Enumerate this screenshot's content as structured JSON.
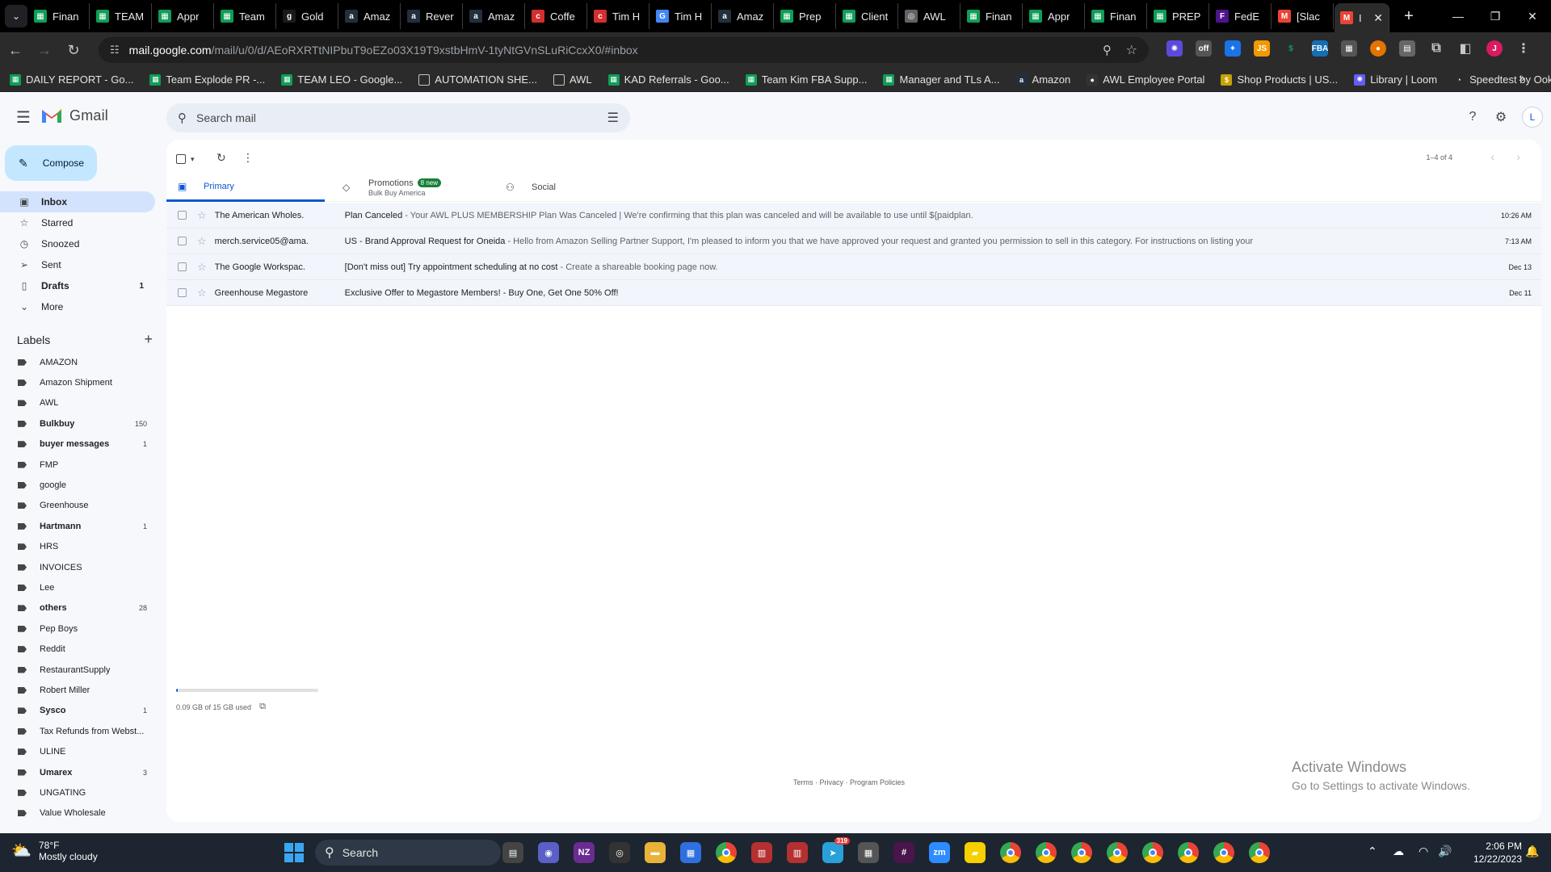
{
  "browser": {
    "tabs": [
      {
        "label": "Finan",
        "icon": "sheets-icon",
        "color": "#0f9d58"
      },
      {
        "label": "TEAM",
        "icon": "sheets-icon",
        "color": "#0f9d58"
      },
      {
        "label": "Appr",
        "icon": "sheets-icon",
        "color": "#0f9d58"
      },
      {
        "label": "Team",
        "icon": "sheets-icon",
        "color": "#0f9d58"
      },
      {
        "label": "Gold",
        "icon": "goldenpages-icon",
        "color": "#1a1a1a"
      },
      {
        "label": "Amaz",
        "icon": "amazon-icon",
        "color": "#232f3e"
      },
      {
        "label": "Rever",
        "icon": "amazon-icon",
        "color": "#232f3e"
      },
      {
        "label": "Amaz",
        "icon": "amazon-icon",
        "color": "#232f3e"
      },
      {
        "label": "Coffe",
        "icon": "coffee-icon",
        "color": "#d32f2f"
      },
      {
        "label": "Tim H",
        "icon": "coffee-icon",
        "color": "#d32f2f"
      },
      {
        "label": "Tim H",
        "icon": "google-icon",
        "color": "#4285f4"
      },
      {
        "label": "Amaz",
        "icon": "amazon-icon",
        "color": "#232f3e"
      },
      {
        "label": "Prep",
        "icon": "sheets-icon",
        "color": "#0f9d58"
      },
      {
        "label": "Client",
        "icon": "sheets-icon",
        "color": "#0f9d58"
      },
      {
        "label": "AWL",
        "icon": "globe-icon",
        "color": "#5f6368"
      },
      {
        "label": "Finan",
        "icon": "sheets-icon",
        "color": "#0f9d58"
      },
      {
        "label": "Appr",
        "icon": "sheets-icon",
        "color": "#0f9d58"
      },
      {
        "label": "Finan",
        "icon": "sheets-icon",
        "color": "#0f9d58"
      },
      {
        "label": "PREP",
        "icon": "sheets-icon",
        "color": "#0f9d58"
      },
      {
        "label": "FedE",
        "icon": "fedex-icon",
        "color": "#4d148c"
      },
      {
        "label": "[Slac",
        "icon": "gmail-icon",
        "color": "#ea4335"
      },
      {
        "label": "I",
        "icon": "gmail-icon",
        "color": "#ea4335"
      }
    ],
    "url_host": "mail.google.com",
    "url_path": "/mail/u/0/d/AEoRXRTtNIPbuT9oEZo03X19T9xstbHmV-1tyNtGVnSLuRiCcxX0/#inbox",
    "profile_initial": "J",
    "bookmarks": [
      {
        "label": "DAILY REPORT - Go...",
        "icon": "sheets-icon",
        "color": "#0f9d58"
      },
      {
        "label": "Team Explode PR -...",
        "icon": "sheets-icon",
        "color": "#0f9d58"
      },
      {
        "label": "TEAM LEO - Google...",
        "icon": "sheets-icon",
        "color": "#0f9d58"
      },
      {
        "label": "AUTOMATION SHE...",
        "icon": "folder-icon",
        "color": "#2b2b2b"
      },
      {
        "label": "AWL",
        "icon": "folder-icon",
        "color": "#2b2b2b"
      },
      {
        "label": "KAD Referrals - Goo...",
        "icon": "sheets-icon",
        "color": "#0f9d58"
      },
      {
        "label": "Team Kim FBA Supp...",
        "icon": "sheets-icon",
        "color": "#0f9d58"
      },
      {
        "label": "Manager and TLs A...",
        "icon": "sheets-icon",
        "color": "#0f9d58"
      },
      {
        "label": "Amazon",
        "icon": "amazon-icon",
        "color": "#232f3e"
      },
      {
        "label": "AWL Employee Portal",
        "icon": "circle-icon",
        "color": "#333"
      },
      {
        "label": "Shop Products | US...",
        "icon": "shop-icon",
        "color": "#c8a200"
      },
      {
        "label": "Library | Loom",
        "icon": "loom-icon",
        "color": "#625df5"
      },
      {
        "label": "Speedtest by Ookla...",
        "icon": "speedtest-icon",
        "color": "#2b2b2b"
      }
    ]
  },
  "gmail": {
    "app_name": "Gmail",
    "search_placeholder": "Search mail",
    "account_initial": "L",
    "compose_label": "Compose",
    "nav": [
      {
        "label": "Inbox",
        "icon": "inbox-icon",
        "count": "",
        "active": true,
        "bold": true
      },
      {
        "label": "Starred",
        "icon": "star-icon",
        "count": "",
        "active": false,
        "bold": false
      },
      {
        "label": "Snoozed",
        "icon": "clock-icon",
        "count": "",
        "active": false,
        "bold": false
      },
      {
        "label": "Sent",
        "icon": "send-icon",
        "count": "",
        "active": false,
        "bold": false
      },
      {
        "label": "Drafts",
        "icon": "draft-icon",
        "count": "1",
        "active": false,
        "bold": true
      },
      {
        "label": "More",
        "icon": "chevron-down-icon",
        "count": "",
        "active": false,
        "bold": false
      }
    ],
    "labels_title": "Labels",
    "labels": [
      {
        "name": "AMAZON",
        "count": "",
        "bold": false
      },
      {
        "name": "Amazon Shipment",
        "count": "",
        "bold": false
      },
      {
        "name": "AWL",
        "count": "",
        "bold": false
      },
      {
        "name": "Bulkbuy",
        "count": "150",
        "bold": true
      },
      {
        "name": "buyer messages",
        "count": "1",
        "bold": true
      },
      {
        "name": "FMP",
        "count": "",
        "bold": false
      },
      {
        "name": "google",
        "count": "",
        "bold": false
      },
      {
        "name": "Greenhouse",
        "count": "",
        "bold": false
      },
      {
        "name": "Hartmann",
        "count": "1",
        "bold": true
      },
      {
        "name": "HRS",
        "count": "",
        "bold": false
      },
      {
        "name": "INVOICES",
        "count": "",
        "bold": false
      },
      {
        "name": "Lee",
        "count": "",
        "bold": false
      },
      {
        "name": "others",
        "count": "28",
        "bold": true
      },
      {
        "name": "Pep Boys",
        "count": "",
        "bold": false
      },
      {
        "name": "Reddit",
        "count": "",
        "bold": false
      },
      {
        "name": "RestaurantSupply",
        "count": "",
        "bold": false
      },
      {
        "name": "Robert Miller",
        "count": "",
        "bold": false
      },
      {
        "name": "Sysco",
        "count": "1",
        "bold": true
      },
      {
        "name": "Tax Refunds from Webst...",
        "count": "",
        "bold": false
      },
      {
        "name": "ULINE",
        "count": "",
        "bold": false
      },
      {
        "name": "Umarex",
        "count": "3",
        "bold": true
      },
      {
        "name": "UNGATING",
        "count": "",
        "bold": false
      },
      {
        "name": "Value Wholesale",
        "count": "",
        "bold": false
      }
    ],
    "pager_text": "1–4 of 4",
    "category_tabs": [
      {
        "label": "Primary",
        "icon": "inbox-icon",
        "sub": "",
        "badge": ""
      },
      {
        "label": "Promotions",
        "icon": "tag-icon",
        "sub": "Bulk Buy America",
        "badge": "8 new"
      },
      {
        "label": "Social",
        "icon": "people-icon",
        "sub": "",
        "badge": ""
      }
    ],
    "emails": [
      {
        "from": "The American Wholes.",
        "subject": "Plan Canceled",
        "snippet": " - Your AWL PLUS MEMBERSHIP Plan Was Canceled | We're confirming that this plan was canceled and will be available to use until ${paidplan.",
        "date": "10:26 AM"
      },
      {
        "from": "merch.service05@ama.",
        "subject": "US - Brand Approval Request for Oneida",
        "snippet": " - Hello from Amazon Selling Partner Support, I'm pleased to inform you that we have approved your request and granted you permission to sell in this category. For instructions on listing your",
        "date": "7:13 AM"
      },
      {
        "from": "The Google Workspac.",
        "subject": "[Don't miss out] Try appointment scheduling at no cost",
        "snippet": " - Create a shareable booking page now.",
        "date": "Dec 13"
      },
      {
        "from": "Greenhouse Megastore",
        "subject": "Exclusive Offer to Megastore Members! - Buy One, Get One 50% Off!",
        "snippet": " - Buy One, Get One 50% Off!",
        "date": "Dec 11"
      }
    ],
    "storage_text": "0.09 GB of 15 GB used",
    "storage_fraction": 0.006,
    "footer": {
      "terms": "Terms",
      "privacy": "Privacy",
      "policies": "Program Policies",
      "sep": " · "
    }
  },
  "watermark": {
    "line1": "Activate Windows",
    "line2": "Go to Settings to activate Windows."
  },
  "taskbar": {
    "weather_temp": "78°F",
    "weather_desc": "Mostly cloudy",
    "search_label": "Search",
    "time": "2:06 PM",
    "date": "12/22/2023",
    "apps": [
      {
        "name": "file-manager-icon",
        "color": "#444"
      },
      {
        "name": "meet-icon",
        "color": "#5b5fc7"
      },
      {
        "name": "nzxt-icon",
        "color": "#6a2c91"
      },
      {
        "name": "chrome-alt-icon",
        "color": "#333"
      },
      {
        "name": "folder-icon",
        "color": "#e8b339"
      },
      {
        "name": "calendar-icon",
        "color": "#2f6fe0"
      },
      {
        "name": "chrome-icon",
        "color": "#2b6cd4"
      },
      {
        "name": "spreadsheet-icon",
        "color": "#b53030"
      },
      {
        "name": "spreadsheet-icon",
        "color": "#b53030"
      },
      {
        "name": "telegram-icon",
        "color": "#2aa0d8"
      },
      {
        "name": "calculator-icon",
        "color": "#555"
      },
      {
        "name": "slack-icon",
        "color": "#4a154b"
      },
      {
        "name": "zoom-icon",
        "color": "#2d8cff"
      },
      {
        "name": "sticky-notes-icon",
        "color": "#f7d000"
      },
      {
        "name": "chrome-icon",
        "color": "#2b6cd4"
      },
      {
        "name": "chrome-icon",
        "color": "#2b6cd4"
      },
      {
        "name": "chrome-icon",
        "color": "#2b6cd4"
      },
      {
        "name": "chrome-icon",
        "color": "#2b6cd4"
      },
      {
        "name": "chrome-icon",
        "color": "#2b6cd4"
      },
      {
        "name": "chrome-icon",
        "color": "#2b6cd4"
      },
      {
        "name": "chrome-icon",
        "color": "#2b6cd4"
      },
      {
        "name": "chrome-icon",
        "color": "#2b6cd4"
      }
    ],
    "telegram_badge": "319"
  }
}
